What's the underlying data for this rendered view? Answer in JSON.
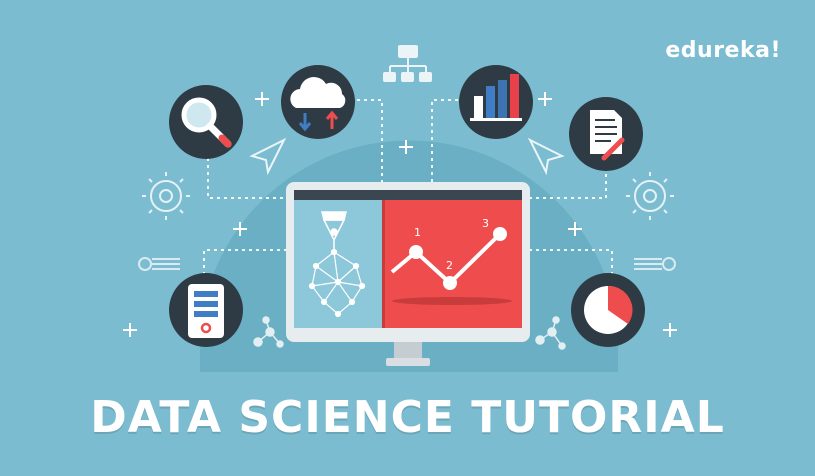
{
  "brand": {
    "name": "edureka!"
  },
  "title": "DATA SCIENCE TUTORIAL",
  "chart_marks": [
    "1",
    "2",
    "3"
  ],
  "colors": {
    "background": "#7bbcd0",
    "dome": "#6aafc3",
    "circle": "#2f3b44",
    "accent_red": "#ef4d4d",
    "screen_left": "#8cc8d9",
    "bar_red": "#e8414a",
    "bar_blue": "#3f7ec4"
  },
  "icons": [
    "magnifier-icon",
    "cloud-sync-icon",
    "bar-chart-icon",
    "document-pen-icon",
    "server-icon",
    "pie-chart-icon",
    "org-chart-icon",
    "gear-icon",
    "paper-plane-icon",
    "pen-nib-icon",
    "network-icon"
  ]
}
